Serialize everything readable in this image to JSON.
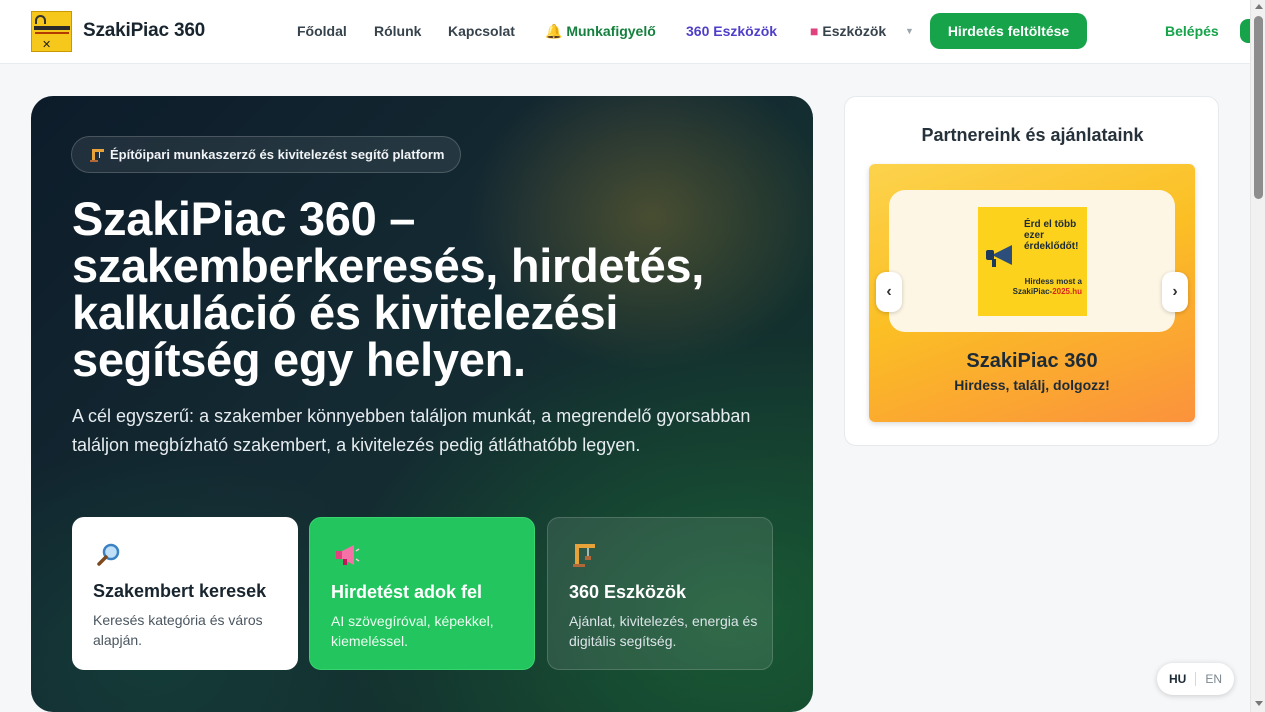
{
  "header": {
    "logo_text": "SzakiPiac-2025.hu",
    "brand": "SzakiPiac 360",
    "nav": {
      "home": "Főoldal",
      "about": "Rólunk",
      "contact": "Kapcsolat",
      "job_alert": "Munkafigyelő",
      "tools_360": "360 Eszközök",
      "tools": "Eszközök"
    },
    "upload_button": "Hirdetés feltöltése",
    "login": "Belépés"
  },
  "hero": {
    "badge": "Építőipari munkaszerző és kivitelezést segítő platform",
    "title": "SzakiPiac 360 – szakemberkeresés, hirdetés, kalkuláció és kivitelezési segítség egy helyen.",
    "subtitle": "A cél egyszerű: a szakember könnyebben találjon munkát, a megrendelő gyorsabban találjon megbízható szakembert, a kivitelezés pedig átláthatóbb legyen.",
    "cards": [
      {
        "icon": "magnifier-icon",
        "title": "Szakembert keresek",
        "desc": "Keresés kategória és város alapján."
      },
      {
        "icon": "megaphone-icon",
        "title": "Hirdetést adok fel",
        "desc": "AI szövegíróval, képekkel, kiemeléssel."
      },
      {
        "icon": "crane-icon",
        "title": "360 Eszközök",
        "desc": "Ajánlat, kivitelezés, energia és digitális segítség."
      }
    ]
  },
  "partners": {
    "title": "Partnereink és ajánlataink",
    "ad_line1": "Érd el több ezer érdeklődőt!",
    "ad_line2_a": "Hirdess most a SzakiPiac-",
    "ad_line2_b": "2025.hu",
    "promo_name": "SzakiPiac 360",
    "promo_tagline": "Hirdess, találj, dolgozz!",
    "prev": "‹",
    "next": "›"
  },
  "language": {
    "hu": "HU",
    "en": "EN"
  },
  "colors": {
    "primary": "#16a34a",
    "accent_purple": "#4f3fc8",
    "hero_dark": "#0d1c2a"
  }
}
